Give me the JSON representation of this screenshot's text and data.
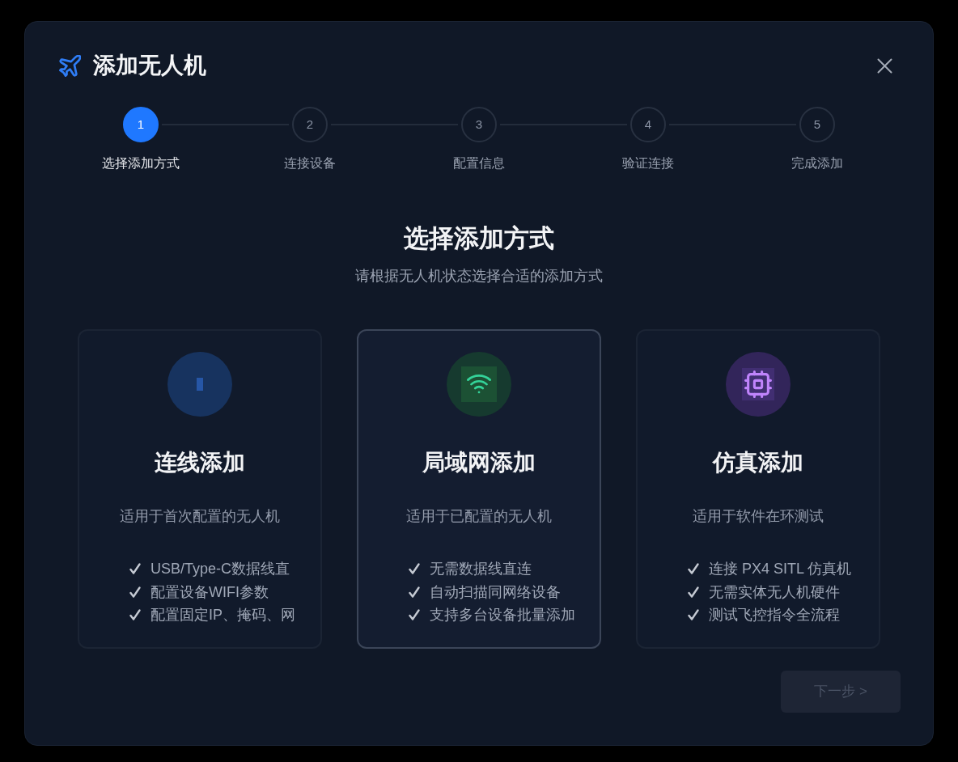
{
  "dialog": {
    "title": "添加无人机"
  },
  "steps": [
    {
      "number": "1",
      "label": "选择添加方式",
      "active": true
    },
    {
      "number": "2",
      "label": "连接设备",
      "active": false
    },
    {
      "number": "3",
      "label": "配置信息",
      "active": false
    },
    {
      "number": "4",
      "label": "验证连接",
      "active": false
    },
    {
      "number": "5",
      "label": "完成添加",
      "active": false
    }
  ],
  "section": {
    "heading": "选择添加方式",
    "subtitle": "请根据无人机状态选择合适的添加方式"
  },
  "methods": [
    {
      "kind": "wired",
      "selected": false,
      "title": "连线添加",
      "description": "适用于首次配置的无人机",
      "features": [
        "USB/Type-C数据线直",
        "配置设备WIFI参数",
        "配置固定IP、掩码、网"
      ]
    },
    {
      "kind": "network",
      "selected": true,
      "title": "局域网添加",
      "description": "适用于已配置的无人机",
      "features": [
        "无需数据线直连",
        "自动扫描同网络设备",
        "支持多台设备批量添加"
      ]
    },
    {
      "kind": "simulation",
      "selected": false,
      "title": "仿真添加",
      "description": "适用于软件在环测试",
      "features": [
        "连接 PX4 SITL 仿真机",
        "无需实体无人机硬件",
        "测试飞控指令全流程"
      ]
    }
  ],
  "next_button": {
    "label": "下一步 >",
    "disabled": true
  }
}
